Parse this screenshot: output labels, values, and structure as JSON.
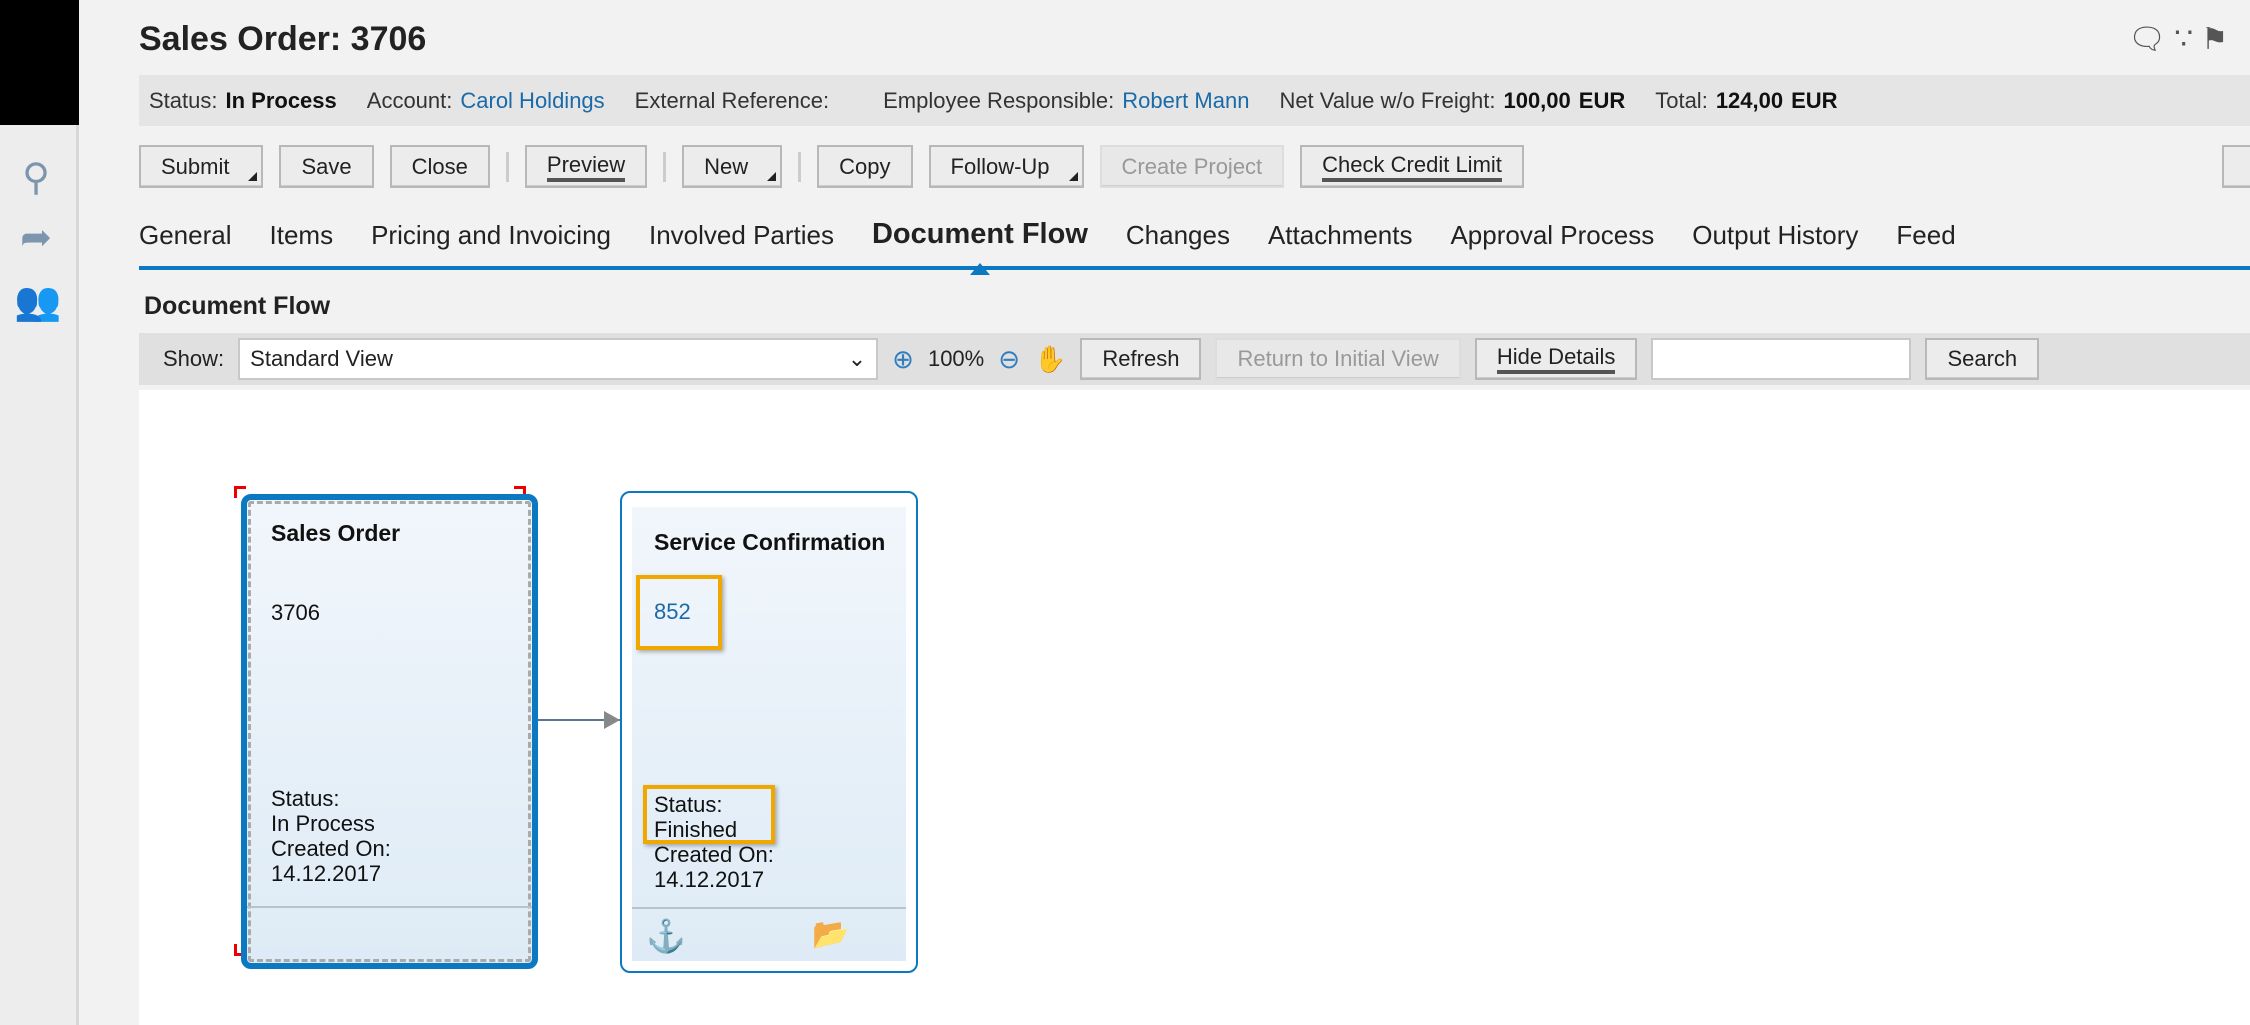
{
  "header": {
    "title": "Sales Order: 3706",
    "icons": [
      "comment-icon",
      "rss-icon",
      "flag-icon"
    ]
  },
  "sidebar": {
    "icons": [
      "search-icon",
      "share-icon",
      "users-icon"
    ]
  },
  "summary": {
    "status_label": "Status:",
    "status": "In Process",
    "account_label": "Account:",
    "account": "Carol Holdings",
    "ext_ref_label": "External Reference:",
    "emp_label": "Employee Responsible:",
    "employee": "Robert Mann",
    "net_label": "Net Value w/o Freight:",
    "net": "100,00",
    "net_cur": "EUR",
    "total_label": "Total:",
    "total": "124,00",
    "total_cur": "EUR"
  },
  "toolbar": {
    "submit": "Submit",
    "save": "Save",
    "close": "Close",
    "preview": "Preview",
    "new": "New",
    "copy": "Copy",
    "followup": "Follow-Up",
    "create_project": "Create Project",
    "check_credit": "Check Credit Limit"
  },
  "tabs": [
    "General",
    "Items",
    "Pricing and Invoicing",
    "Involved Parties",
    "Document Flow",
    "Changes",
    "Attachments",
    "Approval Process",
    "Output History",
    "Feed"
  ],
  "active_tab": "Document Flow",
  "docflow": {
    "title": "Document Flow",
    "show_label": "Show:",
    "view": "Standard View",
    "zoom": "100%",
    "refresh": "Refresh",
    "return": "Return to Initial View",
    "hide": "Hide Details",
    "search_value": "",
    "search": "Search"
  },
  "cards": [
    {
      "title": "Sales Order",
      "number": "3706",
      "status_label": "Status:",
      "status": "In Process",
      "created_label": "Created On:",
      "created": "14.12.2017"
    },
    {
      "title": "Service Confirmation",
      "number": "852",
      "status_label": "Status:",
      "status": "Finished",
      "created_label": "Created On:",
      "created": "14.12.2017",
      "icons": [
        "anchor-icon",
        "folder-icon"
      ]
    }
  ],
  "colors": {
    "accent": "#0a79c2",
    "link": "#1a6aa8",
    "highlight": "#f0a800"
  }
}
